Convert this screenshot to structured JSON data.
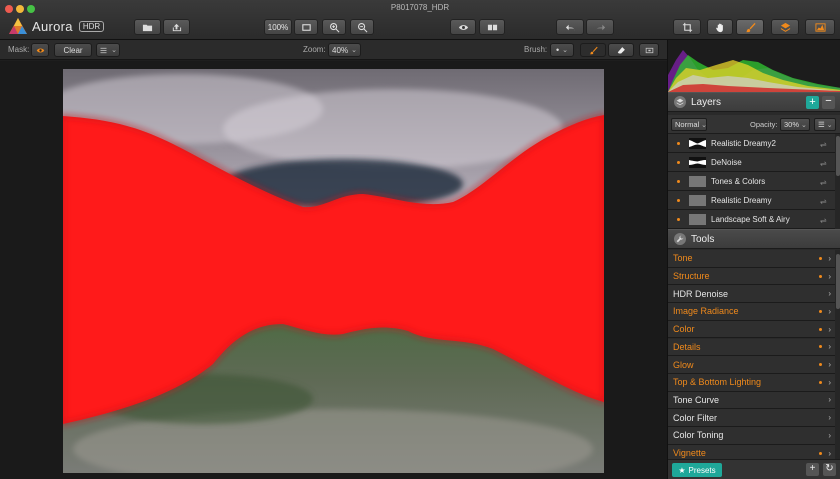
{
  "window": {
    "title": "P8017078_HDR"
  },
  "app": {
    "name": "Aurora",
    "badge": "HDR"
  },
  "toolbar": {
    "zoom_percent": "100%"
  },
  "toolbar2": {
    "mask_label": "Mask:",
    "clear_label": "Clear",
    "zoom_label": "Zoom:",
    "zoom_value": "40%",
    "brush_label": "Brush:"
  },
  "layers": {
    "title": "Layers",
    "blend_mode": "Normal",
    "opacity_label": "Opacity:",
    "opacity_value": "30%",
    "items": [
      {
        "name": "Realistic Dreamy2"
      },
      {
        "name": "DeNoise"
      },
      {
        "name": "Tones & Colors"
      },
      {
        "name": "Realistic Dreamy"
      },
      {
        "name": "Landscape Soft & Airy"
      }
    ]
  },
  "tools": {
    "title": "Tools",
    "items": [
      {
        "name": "Tone",
        "active": true
      },
      {
        "name": "Structure",
        "active": true
      },
      {
        "name": "HDR Denoise",
        "active": false
      },
      {
        "name": "Image Radiance",
        "active": true
      },
      {
        "name": "Color",
        "active": true
      },
      {
        "name": "Details",
        "active": true
      },
      {
        "name": "Glow",
        "active": true
      },
      {
        "name": "Top & Bottom Lighting",
        "active": true
      },
      {
        "name": "Tone Curve",
        "active": false
      },
      {
        "name": "Color Filter",
        "active": false
      },
      {
        "name": "Color Toning",
        "active": false
      },
      {
        "name": "Vignette",
        "active": true
      }
    ]
  },
  "presets": {
    "label": "Presets"
  },
  "colors": {
    "accent_orange": "#f08a1c",
    "teal": "#1fa89a",
    "mask_red": "#ff1a1a"
  }
}
